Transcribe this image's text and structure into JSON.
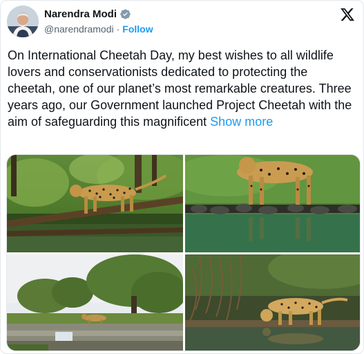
{
  "author": {
    "display_name": "Narendra Modi",
    "handle": "@narendramodi",
    "separator": "·",
    "follow_label": "Follow",
    "verified_color": "#829aab",
    "avatar_icon": "profile-photo"
  },
  "platform": {
    "logo_icon": "x-logo-icon"
  },
  "tweet": {
    "text": "On International Cheetah Day, my best wishes to all wildlife lovers and conservationists dedicated to protecting the cheetah, one of our planet’s most remarkable creatures. Three years ago, our Government launched Project Cheetah with the aim of safeguarding this magnificent ",
    "show_more_label": "Show more"
  },
  "media": {
    "photos": [
      {
        "icon": "cheetah-in-forest-photo"
      },
      {
        "icon": "cheetah-at-waterhole-photo"
      },
      {
        "icon": "cheetah-in-savanna-photo"
      },
      {
        "icon": "cheetah-drinking-photo"
      }
    ]
  },
  "colors": {
    "link": "#1d9bf0",
    "text": "#0f1419",
    "muted": "#536471"
  }
}
